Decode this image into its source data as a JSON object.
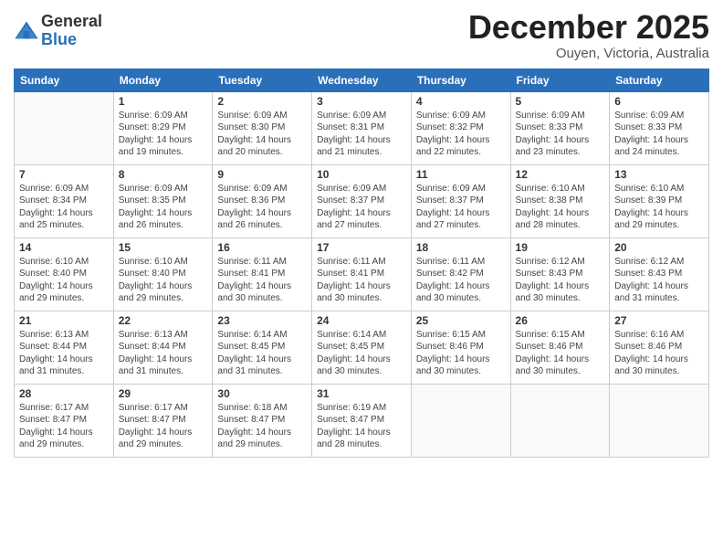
{
  "logo": {
    "general": "General",
    "blue": "Blue"
  },
  "title": "December 2025",
  "location": "Ouyen, Victoria, Australia",
  "days_header": [
    "Sunday",
    "Monday",
    "Tuesday",
    "Wednesday",
    "Thursday",
    "Friday",
    "Saturday"
  ],
  "weeks": [
    [
      {
        "day": "",
        "info": ""
      },
      {
        "day": "1",
        "info": "Sunrise: 6:09 AM\nSunset: 8:29 PM\nDaylight: 14 hours\nand 19 minutes."
      },
      {
        "day": "2",
        "info": "Sunrise: 6:09 AM\nSunset: 8:30 PM\nDaylight: 14 hours\nand 20 minutes."
      },
      {
        "day": "3",
        "info": "Sunrise: 6:09 AM\nSunset: 8:31 PM\nDaylight: 14 hours\nand 21 minutes."
      },
      {
        "day": "4",
        "info": "Sunrise: 6:09 AM\nSunset: 8:32 PM\nDaylight: 14 hours\nand 22 minutes."
      },
      {
        "day": "5",
        "info": "Sunrise: 6:09 AM\nSunset: 8:33 PM\nDaylight: 14 hours\nand 23 minutes."
      },
      {
        "day": "6",
        "info": "Sunrise: 6:09 AM\nSunset: 8:33 PM\nDaylight: 14 hours\nand 24 minutes."
      }
    ],
    [
      {
        "day": "7",
        "info": "Sunrise: 6:09 AM\nSunset: 8:34 PM\nDaylight: 14 hours\nand 25 minutes."
      },
      {
        "day": "8",
        "info": "Sunrise: 6:09 AM\nSunset: 8:35 PM\nDaylight: 14 hours\nand 26 minutes."
      },
      {
        "day": "9",
        "info": "Sunrise: 6:09 AM\nSunset: 8:36 PM\nDaylight: 14 hours\nand 26 minutes."
      },
      {
        "day": "10",
        "info": "Sunrise: 6:09 AM\nSunset: 8:37 PM\nDaylight: 14 hours\nand 27 minutes."
      },
      {
        "day": "11",
        "info": "Sunrise: 6:09 AM\nSunset: 8:37 PM\nDaylight: 14 hours\nand 27 minutes."
      },
      {
        "day": "12",
        "info": "Sunrise: 6:10 AM\nSunset: 8:38 PM\nDaylight: 14 hours\nand 28 minutes."
      },
      {
        "day": "13",
        "info": "Sunrise: 6:10 AM\nSunset: 8:39 PM\nDaylight: 14 hours\nand 29 minutes."
      }
    ],
    [
      {
        "day": "14",
        "info": "Sunrise: 6:10 AM\nSunset: 8:40 PM\nDaylight: 14 hours\nand 29 minutes."
      },
      {
        "day": "15",
        "info": "Sunrise: 6:10 AM\nSunset: 8:40 PM\nDaylight: 14 hours\nand 29 minutes."
      },
      {
        "day": "16",
        "info": "Sunrise: 6:11 AM\nSunset: 8:41 PM\nDaylight: 14 hours\nand 30 minutes."
      },
      {
        "day": "17",
        "info": "Sunrise: 6:11 AM\nSunset: 8:41 PM\nDaylight: 14 hours\nand 30 minutes."
      },
      {
        "day": "18",
        "info": "Sunrise: 6:11 AM\nSunset: 8:42 PM\nDaylight: 14 hours\nand 30 minutes."
      },
      {
        "day": "19",
        "info": "Sunrise: 6:12 AM\nSunset: 8:43 PM\nDaylight: 14 hours\nand 30 minutes."
      },
      {
        "day": "20",
        "info": "Sunrise: 6:12 AM\nSunset: 8:43 PM\nDaylight: 14 hours\nand 31 minutes."
      }
    ],
    [
      {
        "day": "21",
        "info": "Sunrise: 6:13 AM\nSunset: 8:44 PM\nDaylight: 14 hours\nand 31 minutes."
      },
      {
        "day": "22",
        "info": "Sunrise: 6:13 AM\nSunset: 8:44 PM\nDaylight: 14 hours\nand 31 minutes."
      },
      {
        "day": "23",
        "info": "Sunrise: 6:14 AM\nSunset: 8:45 PM\nDaylight: 14 hours\nand 31 minutes."
      },
      {
        "day": "24",
        "info": "Sunrise: 6:14 AM\nSunset: 8:45 PM\nDaylight: 14 hours\nand 30 minutes."
      },
      {
        "day": "25",
        "info": "Sunrise: 6:15 AM\nSunset: 8:46 PM\nDaylight: 14 hours\nand 30 minutes."
      },
      {
        "day": "26",
        "info": "Sunrise: 6:15 AM\nSunset: 8:46 PM\nDaylight: 14 hours\nand 30 minutes."
      },
      {
        "day": "27",
        "info": "Sunrise: 6:16 AM\nSunset: 8:46 PM\nDaylight: 14 hours\nand 30 minutes."
      }
    ],
    [
      {
        "day": "28",
        "info": "Sunrise: 6:17 AM\nSunset: 8:47 PM\nDaylight: 14 hours\nand 29 minutes."
      },
      {
        "day": "29",
        "info": "Sunrise: 6:17 AM\nSunset: 8:47 PM\nDaylight: 14 hours\nand 29 minutes."
      },
      {
        "day": "30",
        "info": "Sunrise: 6:18 AM\nSunset: 8:47 PM\nDaylight: 14 hours\nand 29 minutes."
      },
      {
        "day": "31",
        "info": "Sunrise: 6:19 AM\nSunset: 8:47 PM\nDaylight: 14 hours\nand 28 minutes."
      },
      {
        "day": "",
        "info": ""
      },
      {
        "day": "",
        "info": ""
      },
      {
        "day": "",
        "info": ""
      }
    ]
  ]
}
